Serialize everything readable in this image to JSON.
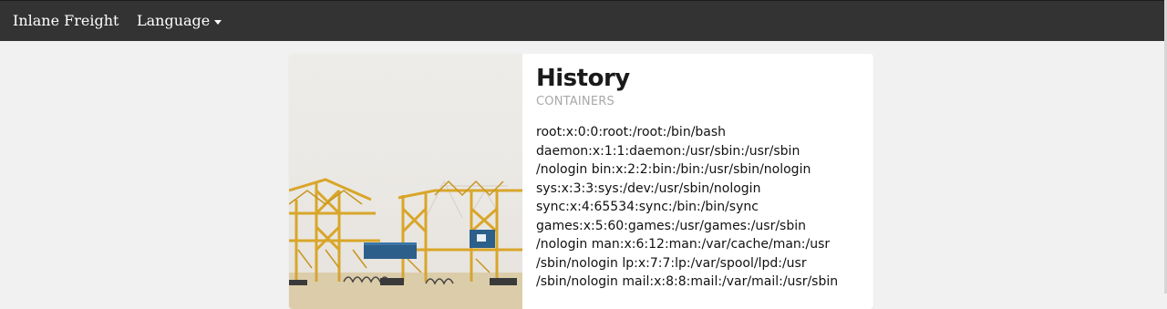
{
  "navbar": {
    "brand": "Inlane Freight",
    "language_label": "Language"
  },
  "card": {
    "image_icon": "container-crane-photo",
    "title": "History",
    "subtitle": "CONTAINERS",
    "lines": [
      "root:x:0:0:root:/root:/bin/bash",
      "daemon:x:1:1:daemon:/usr/sbin:/usr/sbin",
      "/nologin bin:x:2:2:bin:/bin:/usr/sbin/nologin",
      "sys:x:3:3:sys:/dev:/usr/sbin/nologin",
      "sync:x:4:65534:sync:/bin:/bin/sync",
      "games:x:5:60:games:/usr/games:/usr/sbin",
      "/nologin man:x:6:12:man:/var/cache/man:/usr",
      "/sbin/nologin lp:x:7:7:lp:/var/spool/lpd:/usr",
      "/sbin/nologin mail:x:8:8:mail:/var/mail:/usr/sbin"
    ]
  },
  "colors": {
    "navbar_bg": "#333333",
    "page_bg": "#f1f1f1",
    "crane_yellow": "#d9a62a",
    "container_blue": "#2c5f8a"
  }
}
